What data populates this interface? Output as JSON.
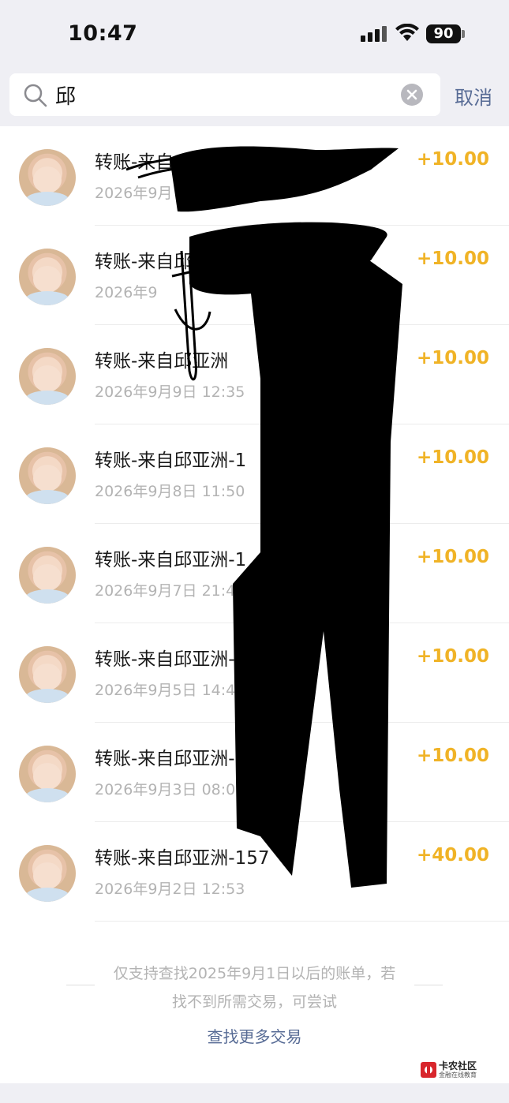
{
  "status_bar": {
    "time": "10:47",
    "battery": "90"
  },
  "search": {
    "query": "邱",
    "cancel_label": "取消"
  },
  "transactions": [
    {
      "title": "转账-来自",
      "date": "2026年9月",
      "amount": "+10.00"
    },
    {
      "title": "转账-来自邱亚洲",
      "date": "2026年9",
      "amount": "+10.00"
    },
    {
      "title": "转账-来自邱亚洲",
      "date": "2026年9月9日 12:35",
      "amount": "+10.00"
    },
    {
      "title": "转账-来自邱亚洲-1",
      "date": "2026年9月8日 11:50",
      "amount": "+10.00"
    },
    {
      "title": "转账-来自邱亚洲-1",
      "date": "2026年9月7日 21:45",
      "amount": "+10.00"
    },
    {
      "title": "转账-来自邱亚洲-1",
      "date": "2026年9月5日 14:4",
      "amount": "+10.00"
    },
    {
      "title": "转账-来自邱亚洲-",
      "date": "2026年9月3日 08:0",
      "amount": "+10.00"
    },
    {
      "title": "转账-来自邱亚洲-157",
      "date": "2026年9月2日 12:53",
      "amount": "+40.00"
    }
  ],
  "footer": {
    "notice_line1": "仅支持查找2025年9月1日以后的账单，若",
    "notice_line2": "找不到所需交易，可尝试",
    "more_link": "查找更多交易"
  },
  "watermark": {
    "name": "卡农社区",
    "sub": "金融在线教育"
  },
  "colors": {
    "amount": "#f0b326",
    "link": "#576b95",
    "background_bar": "#efeff4"
  }
}
